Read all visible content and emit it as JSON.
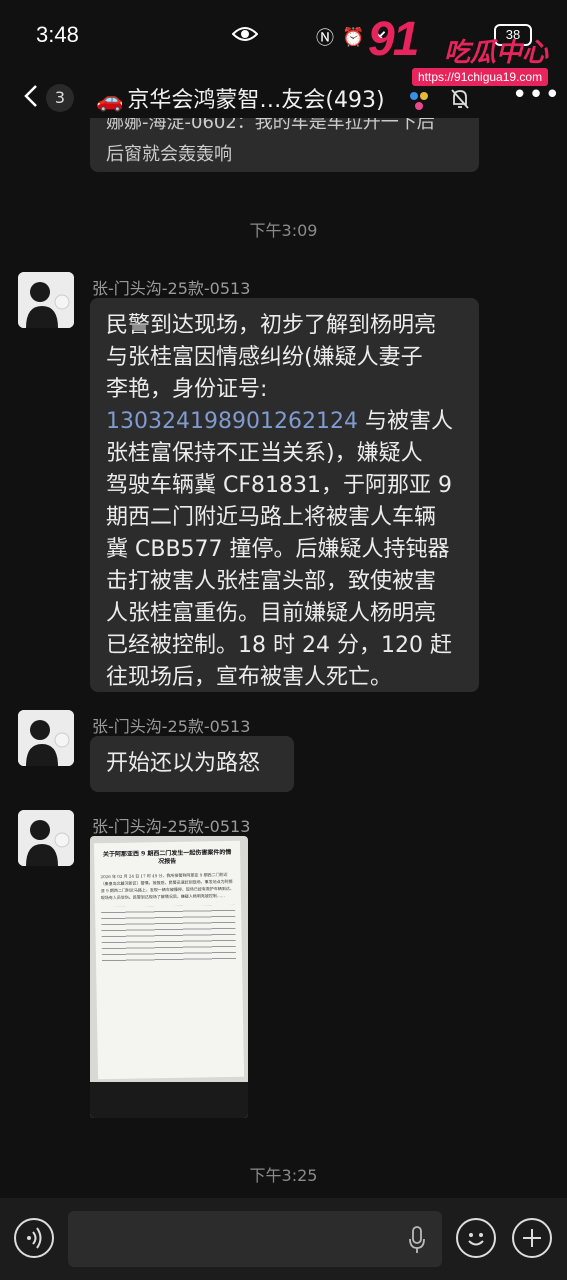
{
  "status": {
    "time": "3:48",
    "battery": "38"
  },
  "watermark": {
    "number": "91",
    "text": "吃瓜中心",
    "url": "https://91chigua19.com"
  },
  "header": {
    "back_badge": "3",
    "title_icon": "🚗",
    "title": "京华会鸿蒙智…友会(493)"
  },
  "top_bubble": {
    "line1": "娜娜-海淀-0602：我的车是车拉开一下后",
    "line2": "后窗就会轰轰响"
  },
  "messages": [
    {
      "timestamp": "下午3:09"
    },
    {
      "sender": "张-门头沟-25款-0513",
      "lines": [
        "民警到达现场，初步了解到杨明亮",
        "与张桂富因情感纠纷(嫌疑人妻子",
        "李艳，身份证号:"
      ],
      "link": "130324198901262124",
      "after_link": " 与被害人",
      "lines2": [
        "张桂富保持不正当关系)，嫌疑人",
        "驾驶车辆冀 CF81831，于阿那亚 9",
        "期西二门附近马路上将被害人车辆",
        "冀 CBB577 撞停。后嫌疑人持钝器",
        "击打被害人张桂富头部，致使被害",
        "人张桂富重伤。目前嫌疑人杨明亮",
        "已经被控制。18 时 24 分，120 赶",
        "往现场后，宣布被害人死亡。"
      ]
    },
    {
      "sender": "张-门头沟-25款-0513",
      "text": "开始还以为路怒"
    },
    {
      "sender": "张-门头沟-25款-0513",
      "doc_title": "关于阿那亚西 9 期西二门发生一起伤害案件的情况报告",
      "doc_body": "2026 年 02 月 24 日 17 时 49 分，我所接警称阿那亚 9 期西二门附近（秦皇岛北戴河新区）警情。接报后，民警迅速赶到现场，事发地点为阿那亚 9 期西二门附近马路上，发现一辆车被撞停，现场已经有救护车辆到达，现场有人员受伤。民警到达现场了解情况后，嫌疑人杨明亮被控制……"
    },
    {
      "timestamp": "下午3:25"
    }
  ]
}
